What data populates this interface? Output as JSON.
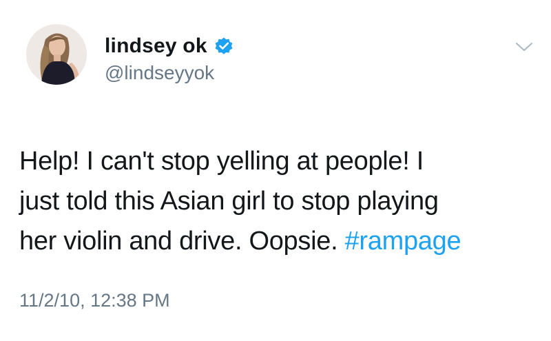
{
  "user": {
    "display_name": "lindsey ok",
    "handle": "@lindseyyok",
    "verified": true,
    "avatar_icon": "profile-photo"
  },
  "tweet": {
    "text_line_1": "Help! I can't stop yelling at people! I",
    "text_line_2": "just told this Asian girl to stop playing",
    "text_line_3_prefix": "her violin and drive. Oopsie. ",
    "hashtag": "#rampage",
    "timestamp": "11/2/10, 12:38 PM"
  },
  "icons": {
    "verified": "verified-badge-icon",
    "menu": "chevron-down-icon"
  },
  "colors": {
    "text": "#14171a",
    "secondary": "#657786",
    "accent": "#1da1f2"
  }
}
